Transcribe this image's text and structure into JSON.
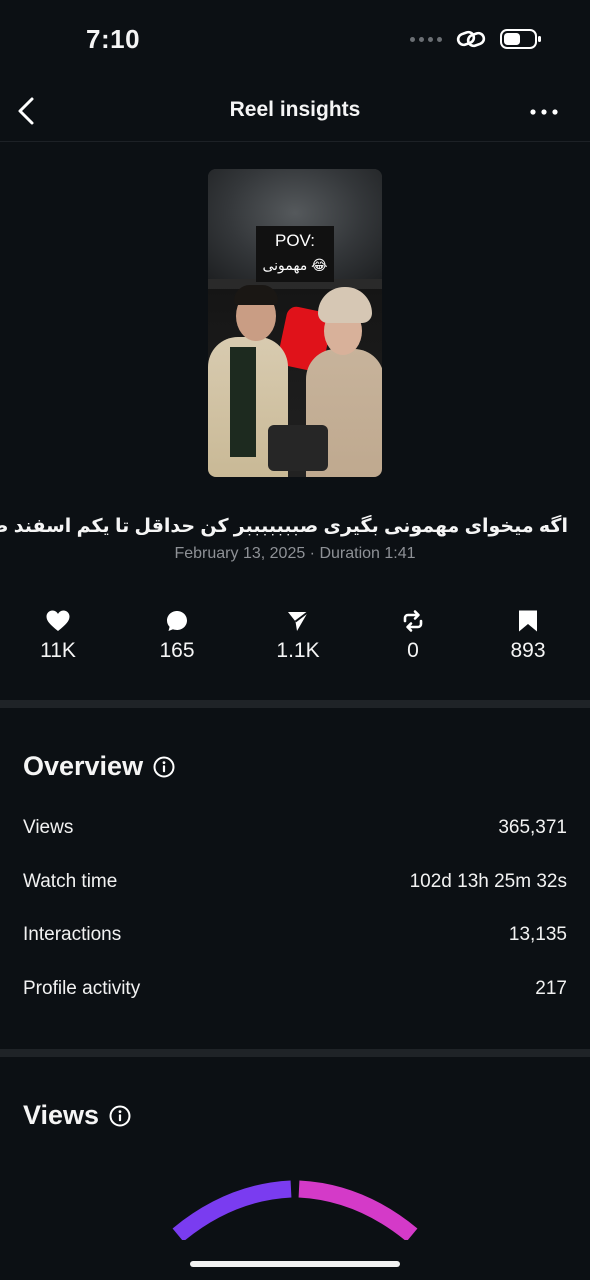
{
  "status_bar": {
    "time": "7:10"
  },
  "nav": {
    "title": "Reel insights",
    "back_icon": "chevron-left-icon",
    "more_icon": "more-horizontal-icon"
  },
  "reel": {
    "thumbnail_caption_line1": "POV:",
    "thumbnail_caption_line2": "مهمونی 😂",
    "title": "اگه میخوای مهمونی بگیری صبببببببر کن حداقل تا یکم اسفند صب...",
    "meta": "February 13, 2025 · Duration 1:41"
  },
  "stats": [
    {
      "icon": "heart-icon",
      "value": "11K"
    },
    {
      "icon": "comment-icon",
      "value": "165"
    },
    {
      "icon": "share-icon",
      "value": "1.1K"
    },
    {
      "icon": "repost-icon",
      "value": "0"
    },
    {
      "icon": "bookmark-icon",
      "value": "893"
    }
  ],
  "overview": {
    "title": "Overview",
    "rows": [
      {
        "label": "Views",
        "value": "365,371"
      },
      {
        "label": "Watch time",
        "value": "102d 13h 25m 32s"
      },
      {
        "label": "Interactions",
        "value": "13,135"
      },
      {
        "label": "Profile activity",
        "value": "217"
      }
    ]
  },
  "views": {
    "title": "Views"
  },
  "colors": {
    "background": "#0c1014",
    "divider": "#1f2327",
    "gauge_left": "#7a3cf0",
    "gauge_right": "#d43ac8",
    "muted_text": "#8e9196"
  }
}
